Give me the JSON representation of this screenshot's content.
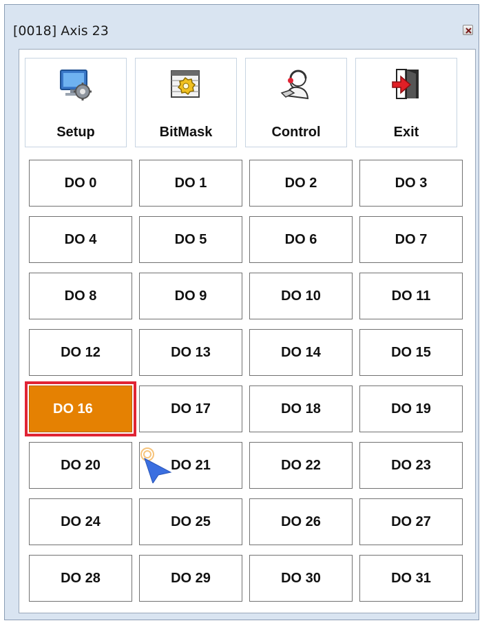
{
  "window": {
    "title": "[0018] Axis 23"
  },
  "toolbar": {
    "buttons": [
      {
        "label": "Setup",
        "icon": "setup-icon"
      },
      {
        "label": "BitMask",
        "icon": "bitmask-icon"
      },
      {
        "label": "Control",
        "icon": "control-icon"
      },
      {
        "label": "Exit",
        "icon": "exit-icon"
      }
    ]
  },
  "outputs": {
    "labels": [
      "DO 0",
      "DO 1",
      "DO 2",
      "DO 3",
      "DO 4",
      "DO 5",
      "DO 6",
      "DO 7",
      "DO 8",
      "DO 9",
      "DO 10",
      "DO 11",
      "DO 12",
      "DO 13",
      "DO 14",
      "DO 15",
      "DO 16",
      "DO 17",
      "DO 18",
      "DO 19",
      "DO 20",
      "DO 21",
      "DO 22",
      "DO 23",
      "DO 24",
      "DO 25",
      "DO 26",
      "DO 27",
      "DO 28",
      "DO 29",
      "DO 30",
      "DO 31"
    ],
    "active_index": 16
  },
  "colors": {
    "active_fill": "#e58102",
    "highlight_border": "#e02434",
    "cursor": "#3b6fe0"
  }
}
